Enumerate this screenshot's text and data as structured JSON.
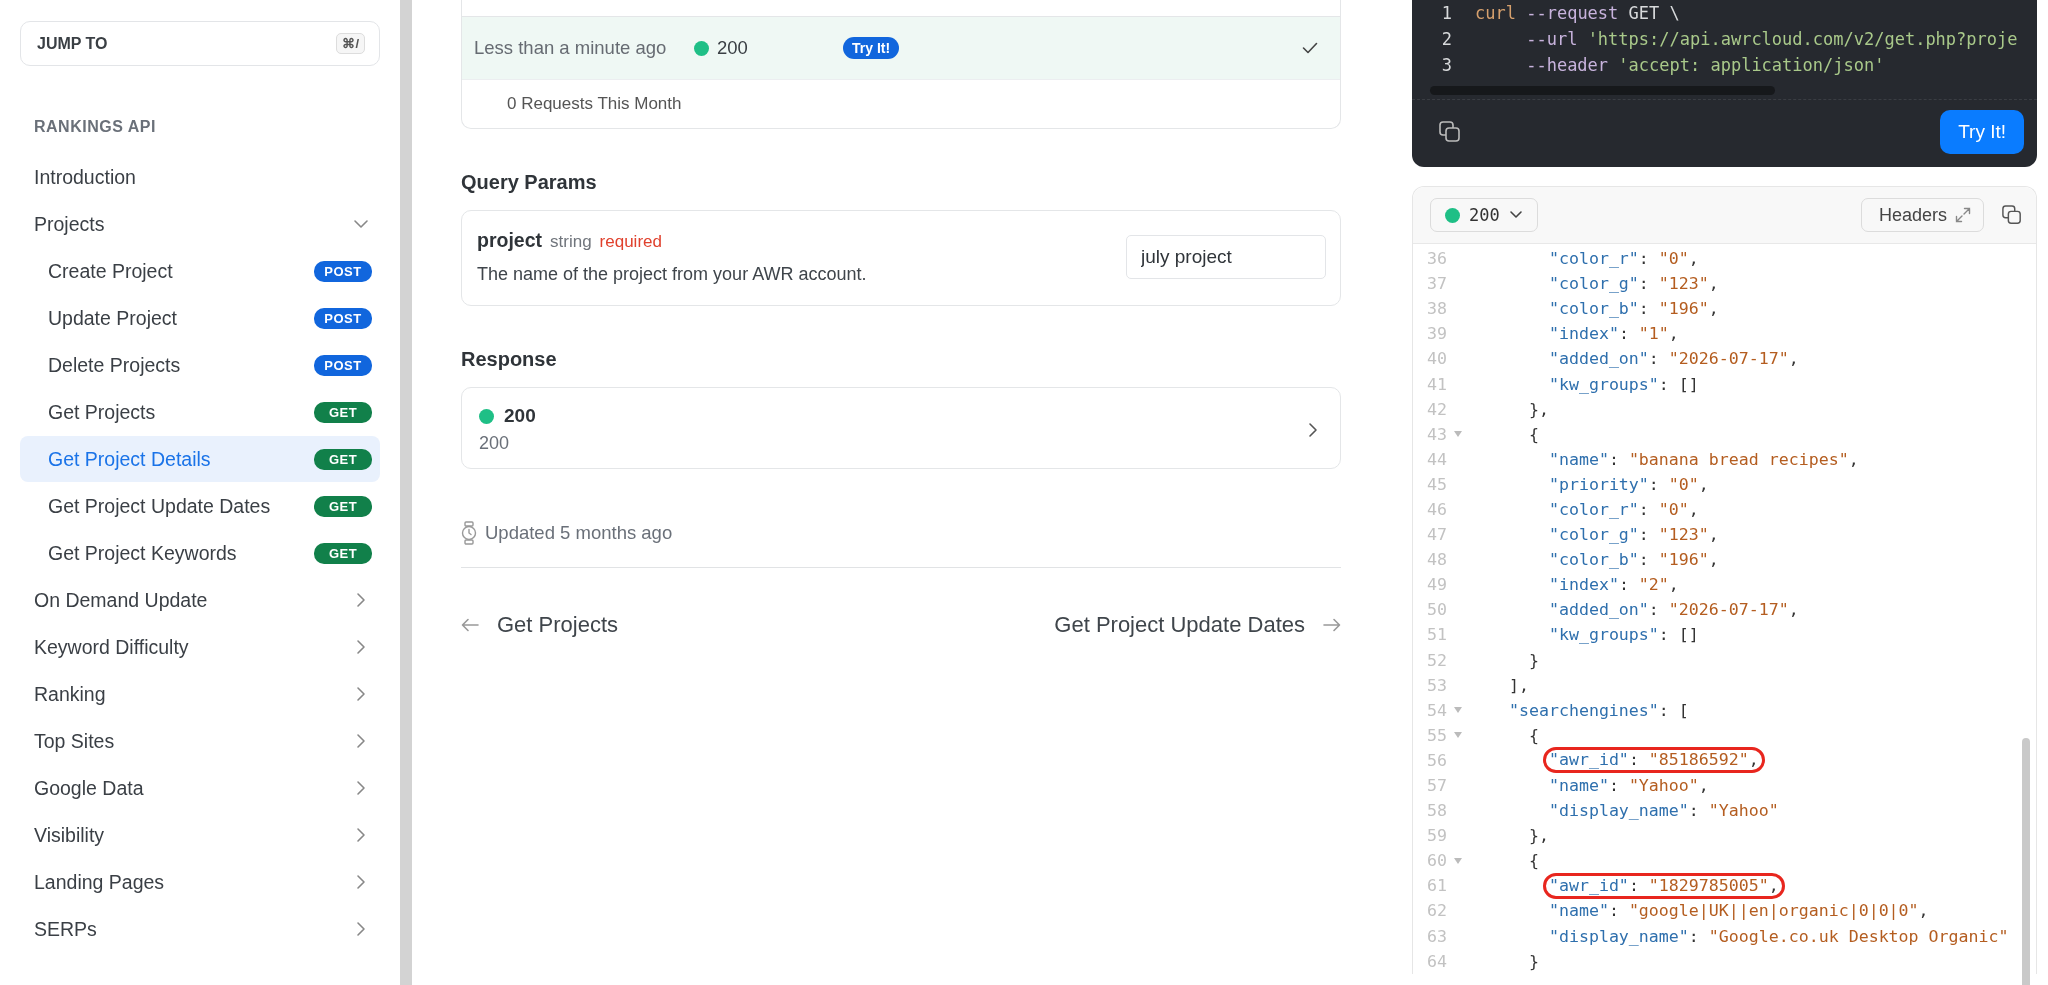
{
  "sidebar": {
    "jump_to": {
      "label": "JUMP TO",
      "shortcut": "⌘/"
    },
    "section_title": "RANKINGS API",
    "items": [
      {
        "label": "Introduction",
        "kind": "link",
        "selected": false
      },
      {
        "label": "Projects",
        "kind": "group",
        "expanded": true,
        "selected": false,
        "children": [
          {
            "label": "Create Project",
            "method": "POST",
            "kind": "post",
            "selected": false
          },
          {
            "label": "Update Project",
            "method": "POST",
            "kind": "post",
            "selected": false
          },
          {
            "label": "Delete Projects",
            "method": "POST",
            "kind": "post",
            "selected": false
          },
          {
            "label": "Get Projects",
            "method": "GET",
            "kind": "get",
            "selected": false
          },
          {
            "label": "Get Project Details",
            "method": "GET",
            "kind": "get",
            "selected": true
          },
          {
            "label": "Get Project Update Dates",
            "method": "GET",
            "kind": "get",
            "selected": false
          },
          {
            "label": "Get Project Keywords",
            "method": "GET",
            "kind": "get",
            "selected": false
          }
        ]
      },
      {
        "label": "On Demand Update",
        "kind": "group",
        "expanded": false,
        "selected": false
      },
      {
        "label": "Keyword Difficulty",
        "kind": "group",
        "expanded": false,
        "selected": false
      },
      {
        "label": "Ranking",
        "kind": "group",
        "expanded": false,
        "selected": false
      },
      {
        "label": "Top Sites",
        "kind": "group",
        "expanded": false,
        "selected": false
      },
      {
        "label": "Google Data",
        "kind": "group",
        "expanded": false,
        "selected": false
      },
      {
        "label": "Visibility",
        "kind": "group",
        "expanded": false,
        "selected": false
      },
      {
        "label": "Landing Pages",
        "kind": "group",
        "expanded": false,
        "selected": false
      },
      {
        "label": "SERPs",
        "kind": "group",
        "expanded": false,
        "selected": false
      }
    ]
  },
  "history": {
    "rows": [
      {
        "time": "Less than a minute ago",
        "status": "200",
        "action": "Try It!",
        "selected": true
      }
    ],
    "footer": "0 Requests This Month"
  },
  "query_params": {
    "heading": "Query Params",
    "params": [
      {
        "name": "project",
        "type": "string",
        "required": "required",
        "description": "The name of the project from your AWR account.",
        "value": "july project"
      }
    ]
  },
  "response": {
    "heading": "Response",
    "items": [
      {
        "code": "200",
        "description": "200"
      }
    ]
  },
  "updated": "Updated 5 months ago",
  "nav": {
    "previous": "Get Projects",
    "next": "Get Project Update Dates"
  },
  "request": {
    "lines": [
      {
        "number": "1",
        "text": "curl --request GET \\"
      },
      {
        "number": "2",
        "text": "     --url 'https://api.awrcloud.com/v2/get.php?proje"
      },
      {
        "number": "3",
        "text": "     --header 'accept: application/json'"
      }
    ],
    "action": "Try It!"
  },
  "response_panel": {
    "status": "200",
    "headers_button": "Headers",
    "lines": [
      {
        "number": "36",
        "text": "        \"color_r\": \"0\",",
        "foldable": false,
        "highlighted": false
      },
      {
        "number": "37",
        "text": "        \"color_g\": \"123\",",
        "foldable": false,
        "highlighted": false
      },
      {
        "number": "38",
        "text": "        \"color_b\": \"196\",",
        "foldable": false,
        "highlighted": false
      },
      {
        "number": "39",
        "text": "        \"index\": \"1\",",
        "foldable": false,
        "highlighted": false
      },
      {
        "number": "40",
        "text": "        \"added_on\": \"2026-07-17\",",
        "foldable": false,
        "highlighted": false
      },
      {
        "number": "41",
        "text": "        \"kw_groups\": []",
        "foldable": false,
        "highlighted": false
      },
      {
        "number": "42",
        "text": "      },",
        "foldable": false,
        "highlighted": false
      },
      {
        "number": "43",
        "text": "      {",
        "foldable": true,
        "highlighted": false
      },
      {
        "number": "44",
        "text": "        \"name\": \"banana bread recipes\",",
        "foldable": false,
        "highlighted": false
      },
      {
        "number": "45",
        "text": "        \"priority\": \"0\",",
        "foldable": false,
        "highlighted": false
      },
      {
        "number": "46",
        "text": "        \"color_r\": \"0\",",
        "foldable": false,
        "highlighted": false
      },
      {
        "number": "47",
        "text": "        \"color_g\": \"123\",",
        "foldable": false,
        "highlighted": false
      },
      {
        "number": "48",
        "text": "        \"color_b\": \"196\",",
        "foldable": false,
        "highlighted": false
      },
      {
        "number": "49",
        "text": "        \"index\": \"2\",",
        "foldable": false,
        "highlighted": false
      },
      {
        "number": "50",
        "text": "        \"added_on\": \"2026-07-17\",",
        "foldable": false,
        "highlighted": false
      },
      {
        "number": "51",
        "text": "        \"kw_groups\": []",
        "foldable": false,
        "highlighted": false
      },
      {
        "number": "52",
        "text": "      }",
        "foldable": false,
        "highlighted": false
      },
      {
        "number": "53",
        "text": "    ],",
        "foldable": false,
        "highlighted": false
      },
      {
        "number": "54",
        "text": "    \"searchengines\": [",
        "foldable": true,
        "highlighted": false
      },
      {
        "number": "55",
        "text": "      {",
        "foldable": true,
        "highlighted": false
      },
      {
        "number": "56",
        "text": "        \"awr_id\": \"85186592\",",
        "foldable": false,
        "highlighted": true
      },
      {
        "number": "57",
        "text": "        \"name\": \"Yahoo\",",
        "foldable": false,
        "highlighted": false
      },
      {
        "number": "58",
        "text": "        \"display_name\": \"Yahoo\"",
        "foldable": false,
        "highlighted": false
      },
      {
        "number": "59",
        "text": "      },",
        "foldable": false,
        "highlighted": false
      },
      {
        "number": "60",
        "text": "      {",
        "foldable": true,
        "highlighted": false
      },
      {
        "number": "61",
        "text": "        \"awr_id\": \"1829785005\",",
        "foldable": false,
        "highlighted": true
      },
      {
        "number": "62",
        "text": "        \"name\": \"google|UK||en|organic|0|0|0\",",
        "foldable": false,
        "highlighted": false
      },
      {
        "number": "63",
        "text": "        \"display_name\": \"Google.co.uk Desktop Organic\"",
        "foldable": false,
        "highlighted": false
      },
      {
        "number": "64",
        "text": "      }",
        "foldable": false,
        "highlighted": false
      }
    ]
  }
}
